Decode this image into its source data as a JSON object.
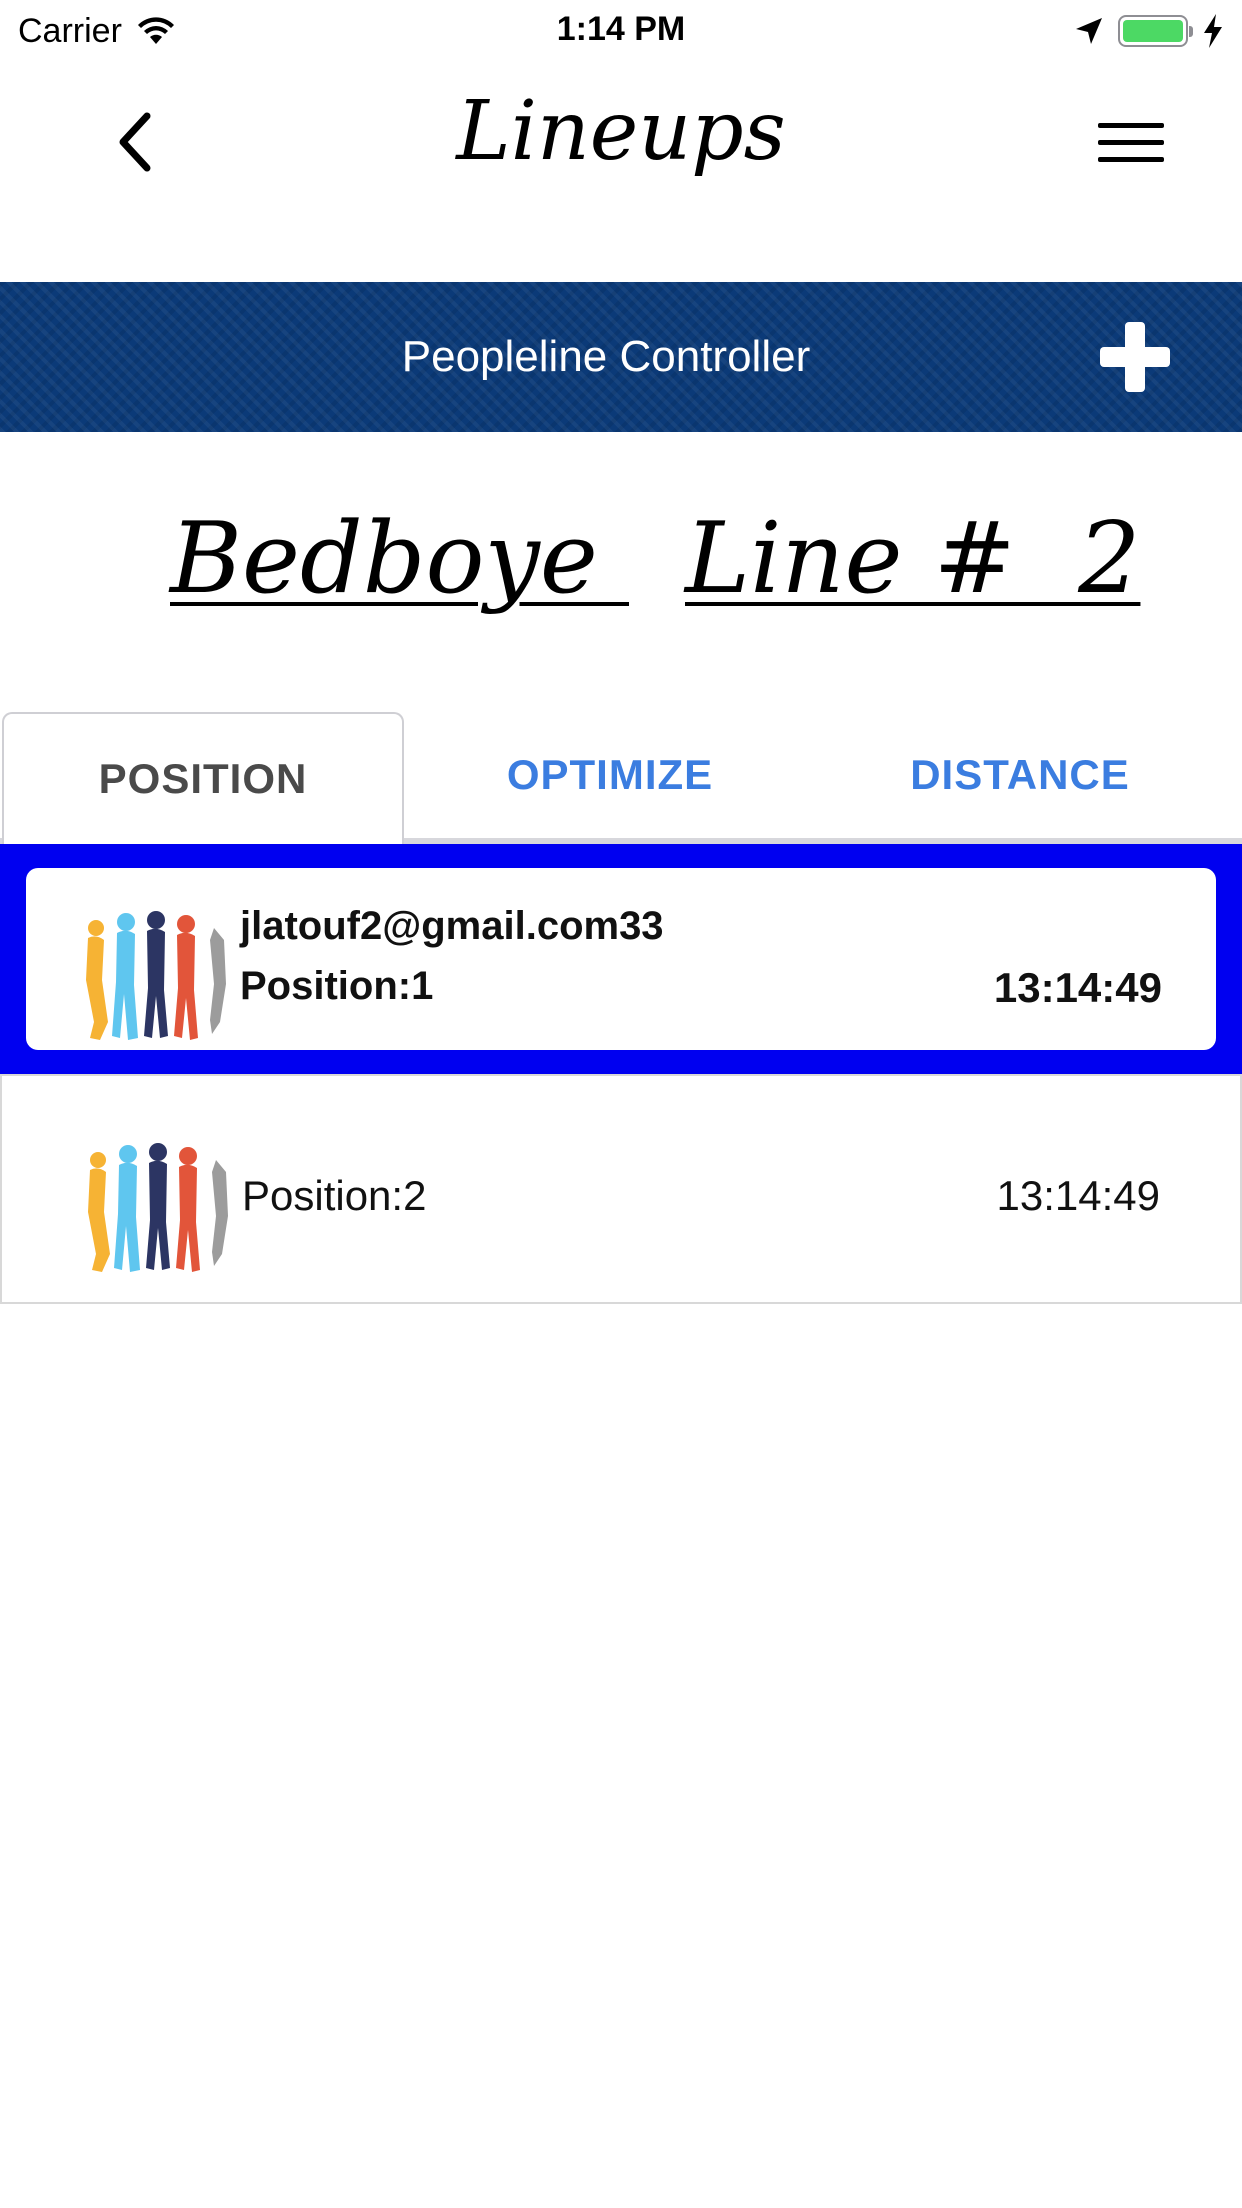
{
  "status_bar": {
    "carrier": "Carrier",
    "time": "1:14 PM",
    "colors": {
      "battery": "#4cd964"
    }
  },
  "nav": {
    "title": "Lineups",
    "icons": {
      "back": "chevron-left-icon",
      "menu": "hamburger-menu-icon"
    }
  },
  "banner": {
    "title": "Peopleline Controller",
    "background_color": "#0b3a78",
    "add_icon": "plus-icon"
  },
  "headers": {
    "left": "Bedboye ",
    "right": "Line #  2"
  },
  "tabs": [
    {
      "label": "POSITION",
      "active": true
    },
    {
      "label": "OPTIMIZE",
      "active": false
    },
    {
      "label": "DISTANCE",
      "active": false
    }
  ],
  "list": [
    {
      "email": "jlatouf2@gmail.com33",
      "position": "Position:1",
      "time": "13:14:49",
      "selected": true,
      "icon": "people-line-icon"
    },
    {
      "email": "",
      "position": "Position:2",
      "time": "13:14:49",
      "selected": false,
      "icon": "people-line-icon"
    }
  ],
  "colors": {
    "selected_border": "#0000f0",
    "tab_link": "#3b7de0"
  }
}
